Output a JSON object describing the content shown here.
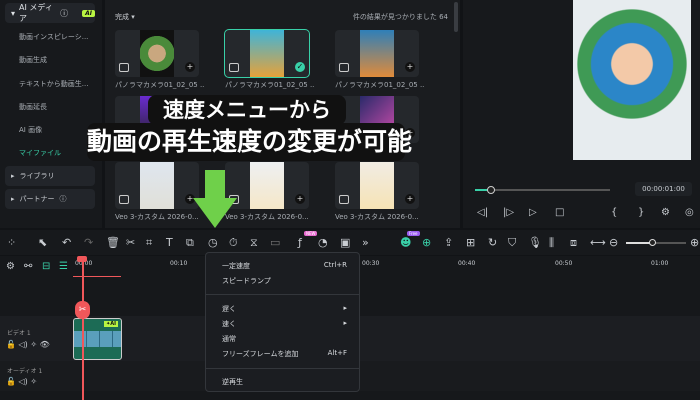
{
  "sidebar": {
    "ai_media": "AI メディア",
    "ai_badge": "AI",
    "items": [
      "動画インスピレーシ...",
      "動画生成",
      "テキストから動画生...",
      "動画延長",
      "AI 画像",
      "マイファイル"
    ],
    "library": "ライブラリ",
    "partner": "パートナー"
  },
  "media": {
    "filter": "完成",
    "results": "件の結果が見つかりました 64",
    "cards": [
      {
        "label": "パノラマカメラ01_02_05 ..."
      },
      {
        "label": "パノラマカメラ01_02_05 ..."
      },
      {
        "label": "パノラマカメラ01_02_05 ..."
      },
      {
        "label": ""
      },
      {
        "label": ""
      },
      {
        "label": ""
      },
      {
        "label": "Veo 3-カスタム 2026-0..."
      },
      {
        "label": "Veo 3-カスタム 2026-0..."
      },
      {
        "label": "Veo 3-カスタム 2026-0..."
      }
    ]
  },
  "preview": {
    "timecode": "00:00:01:00",
    "progress": 0.12
  },
  "toolbar": {
    "new_badge": "NEW",
    "free_badge": "Free"
  },
  "timeline": {
    "ruler": [
      "00:00",
      "00:10",
      "00:30",
      "00:40",
      "00:50",
      "01:00"
    ],
    "video_track": "ビデオ 1",
    "audio_track": "オーディオ 1",
    "clip_badge": "✦AI"
  },
  "speed_menu": {
    "items": [
      {
        "label": "一定速度",
        "shortcut": "Ctrl+R"
      },
      {
        "label": "スピードランプ",
        "shortcut": ""
      },
      {
        "label": "遅く",
        "shortcut": "▸"
      },
      {
        "label": "速く",
        "shortcut": "▸"
      },
      {
        "label": "通常",
        "shortcut": ""
      },
      {
        "label": "フリーズフレームを追加",
        "shortcut": "Alt+F"
      },
      {
        "label": "逆再生",
        "shortcut": ""
      }
    ]
  },
  "overlay": {
    "line1": "速度メニューから",
    "line2": "動画の再生速度の変更が可能"
  },
  "colors": {
    "accent": "#39d0a8",
    "playhead": "#f0575a",
    "arrow": "#6fd04a"
  }
}
